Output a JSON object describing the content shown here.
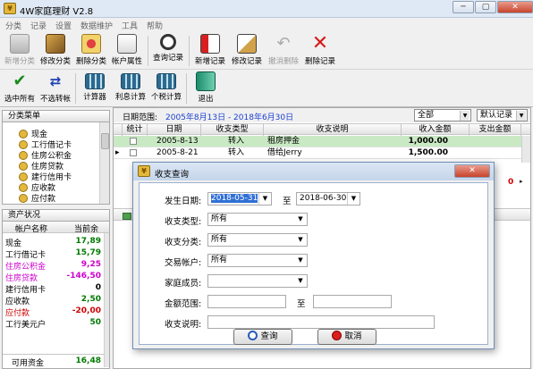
{
  "window": {
    "title": "4W家庭理财 V2.8",
    "min_icon": "minimize-icon",
    "max_icon": "maximize-icon",
    "close_icon": "close-icon"
  },
  "menu": [
    "分类",
    "记录",
    "设置",
    "数据维护",
    "工具",
    "帮助"
  ],
  "toolbar1": [
    {
      "label": "新增分类",
      "icon": "folder-add-icon",
      "disabled": true
    },
    {
      "label": "修改分类",
      "icon": "hammer-icon",
      "disabled": false
    },
    {
      "label": "删除分类",
      "icon": "delete-folder-icon",
      "disabled": false
    },
    {
      "label": "帐户属性",
      "icon": "account-properties-icon",
      "disabled": false
    },
    {
      "label": "查询记录",
      "icon": "search-icon",
      "disabled": false
    },
    {
      "label": "新增记录",
      "icon": "add-record-icon",
      "disabled": false
    },
    {
      "label": "修改记录",
      "icon": "edit-record-icon",
      "disabled": false
    },
    {
      "label": "撤消删除",
      "icon": "undo-icon",
      "disabled": true
    },
    {
      "label": "删除记录",
      "icon": "delete-x-icon",
      "disabled": false
    }
  ],
  "toolbar2": [
    {
      "label": "选中所有",
      "icon": "check-icon"
    },
    {
      "label": "不选转帐",
      "icon": "transfer-arrows-icon"
    },
    {
      "label": "计算器",
      "icon": "calculator-icon"
    },
    {
      "label": "利息计算",
      "icon": "interest-calculator-icon"
    },
    {
      "label": "个税计算",
      "icon": "tax-calculator-icon"
    },
    {
      "label": "退出",
      "icon": "exit-door-icon"
    }
  ],
  "category_panel": {
    "title": "分类菜单",
    "items": [
      "现金",
      "工行借记卡",
      "住房公积金",
      "住房贷款",
      "建行信用卡",
      "应收款",
      "应付款"
    ]
  },
  "assets_panel": {
    "title": "资产状况",
    "col_name": "帐户名称",
    "col_balance": "当前余",
    "rows": [
      {
        "name": "现金",
        "value": "17,89",
        "color": "#007a00"
      },
      {
        "name": "工行借记卡",
        "value": "15,79",
        "color": "#007a00"
      },
      {
        "name": "住房公积金",
        "value": "9,25",
        "color": "#cc00cc"
      },
      {
        "name": "住房贷款",
        "value": "-146,50",
        "color": "#cc00cc"
      },
      {
        "name": "建行信用卡",
        "value": "0",
        "color": "#000000"
      },
      {
        "name": "应收款",
        "value": "2,50",
        "color": "#007a00"
      },
      {
        "name": "应付款",
        "value": "-20,00",
        "color": "#cc0000"
      },
      {
        "name": "工行美元户",
        "value": "50",
        "color": "#007a00"
      }
    ],
    "footer_label": "可用资金",
    "footer_value": "16,48"
  },
  "records": {
    "date_range_label": "日期范围:",
    "date_range_value": "2005年8月13日 - 2018年6月30日",
    "filter_combo": "全部",
    "sort_combo": "默认记录",
    "columns": [
      "统计",
      "日期",
      "收支类型",
      "收支说明",
      "收入金额",
      "支出金额"
    ],
    "rows": [
      {
        "date": "2005-8-13",
        "type": "转入",
        "desc": "租房押金",
        "income": "1,000.00",
        "expense": ""
      },
      {
        "date": "2005-8-21",
        "type": "转入",
        "desc": "借给Jerry",
        "income": "1,500.00",
        "expense": ""
      }
    ],
    "side_zero": "0"
  },
  "dialog": {
    "title": "收支查询",
    "close_icon": "close-icon",
    "date_label": "发生日期:",
    "date_from": "2018-05-31",
    "date_to_sep": "至",
    "date_to": "2018-06-30",
    "type_label": "收支类型:",
    "type_value": "所有",
    "category_label": "收支分类:",
    "category_value": "所有",
    "account_label": "交易帐户:",
    "account_value": "所有",
    "member_label": "家庭成员:",
    "member_value": "",
    "amount_label": "金额范围:",
    "amount_sep": "至",
    "amount_from": "",
    "amount_to": "",
    "desc_label": "收支说明:",
    "desc_value": "",
    "query_button": "查询",
    "cancel_button": "取消"
  }
}
